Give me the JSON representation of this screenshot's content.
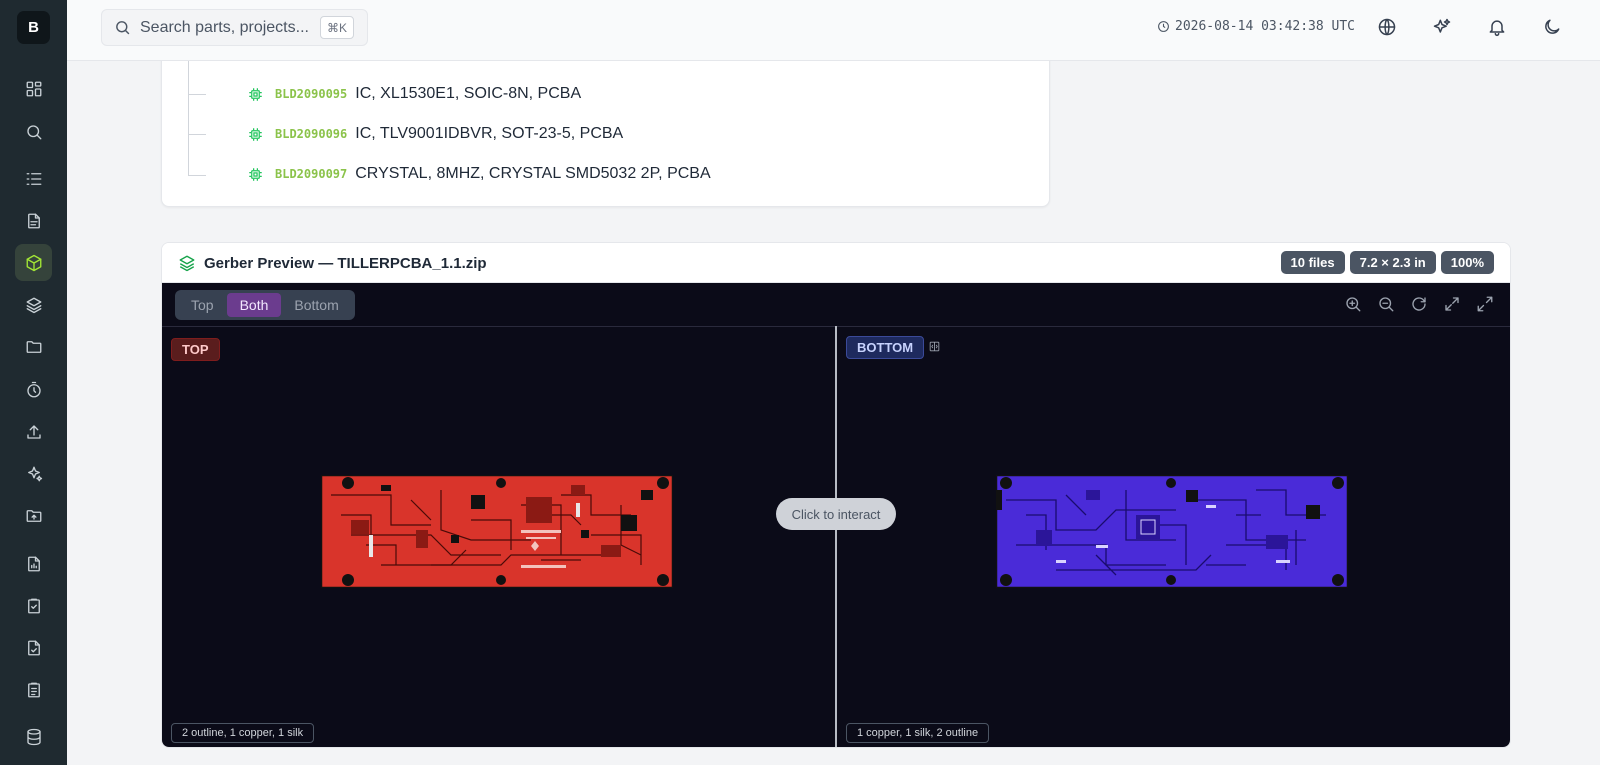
{
  "app": {
    "logo_letter": "B"
  },
  "sidebar": {
    "items": [
      {
        "name": "dashboard-icon"
      },
      {
        "name": "search-icon"
      },
      {
        "name": "list-icon"
      },
      {
        "name": "document-icon"
      },
      {
        "name": "package-icon",
        "active": true
      },
      {
        "name": "layers-icon"
      },
      {
        "name": "folder-icon"
      },
      {
        "name": "timer-icon"
      },
      {
        "name": "upload-icon"
      },
      {
        "name": "sparkles-icon"
      },
      {
        "name": "folder-upload-icon"
      },
      {
        "name": "file-chart-icon"
      },
      {
        "name": "clipboard-check-icon"
      },
      {
        "name": "file-check-icon"
      },
      {
        "name": "clipboard-list-icon"
      },
      {
        "name": "database-icon"
      }
    ]
  },
  "topbar": {
    "search_placeholder": "Search parts, projects...",
    "shortcut": "⌘K",
    "timestamp": "2026-08-14 03:42:38 UTC"
  },
  "bom": {
    "rows": [
      {
        "pn": "BLD2090095",
        "desc": "IC, XL1530E1, SOIC-8N, PCBA"
      },
      {
        "pn": "BLD2090096",
        "desc": "IC, TLV9001IDBVR, SOT-23-5, PCBA"
      },
      {
        "pn": "BLD2090097",
        "desc": "CRYSTAL, 8MHZ, CRYSTAL SMD5032 2P, PCBA"
      }
    ]
  },
  "gerber": {
    "title": "Gerber Preview — TILLERPCBA_1.1.zip",
    "badges": {
      "files": "10 files",
      "size": "7.2 × 2.3 in",
      "zoom": "100%"
    },
    "view_modes": [
      "Top",
      "Both",
      "Bottom"
    ],
    "active_mode": "Both",
    "top_label": "TOP",
    "bottom_label": "BOTTOM",
    "top_layers": "2 outline, 1 copper, 1 silk",
    "bottom_layers": "1 copper, 1 silk, 2 outline",
    "interact_hint": "Click to interact"
  },
  "colors": {
    "accent": "#a3e635",
    "top_board": "#d9342b",
    "bottom_board": "#4a2bd8",
    "viewer_bg": "#0b0b18"
  }
}
